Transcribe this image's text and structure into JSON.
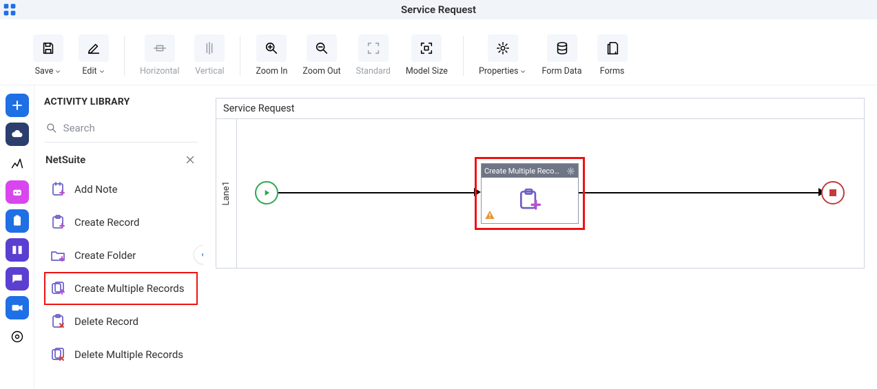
{
  "header": {
    "title": "Service Request"
  },
  "toolbar": {
    "save": "Save",
    "edit": "Edit",
    "horizontal": "Horizontal",
    "vertical": "Vertical",
    "zoom_in": "Zoom In",
    "zoom_out": "Zoom Out",
    "standard": "Standard",
    "model_size": "Model Size",
    "properties": "Properties",
    "form_data": "Form Data",
    "forms": "Forms"
  },
  "sidebar": {
    "title": "ACTIVITY LIBRARY",
    "search_placeholder": "Search",
    "category": "NetSuite",
    "items": [
      {
        "label": "Add Note"
      },
      {
        "label": "Create Record"
      },
      {
        "label": "Create Folder"
      },
      {
        "label": "Create Multiple Records"
      },
      {
        "label": "Delete Record"
      },
      {
        "label": "Delete Multiple Records"
      }
    ]
  },
  "process": {
    "title": "Service Request",
    "lane": "Lane1",
    "node_label": "Create Multiple Reco..."
  }
}
